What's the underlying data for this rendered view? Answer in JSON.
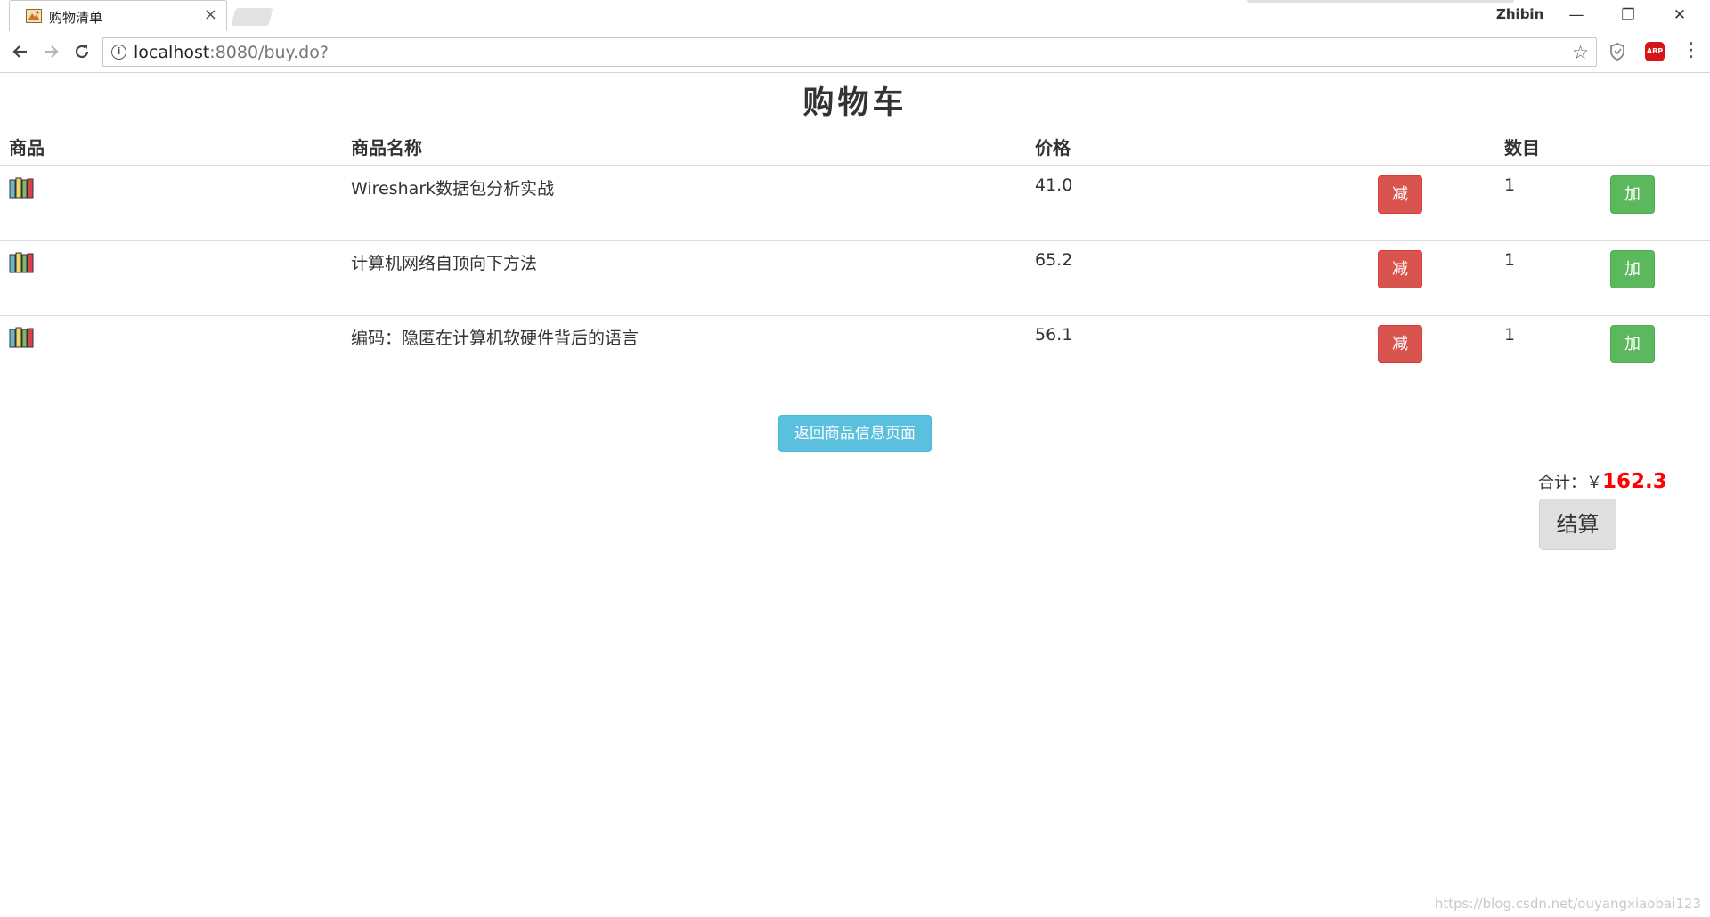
{
  "browser": {
    "tab_title": "购物清单",
    "tab_close": "×",
    "profile_name": "Zhibin",
    "window_controls": {
      "minimize": "—",
      "restore": "❐",
      "close": "✕"
    },
    "url_host": "localhost",
    "url_rest": ":8080/buy.do?",
    "icons": [
      "back-arrow-icon",
      "forward-arrow-icon",
      "reload-icon",
      "info-icon",
      "star-icon",
      "shield-icon",
      "abp-icon",
      "menu-icon"
    ],
    "abp_label": "ABP"
  },
  "page": {
    "title": "购物车",
    "headers": {
      "image": "商品",
      "name": "商品名称",
      "price": "价格",
      "qty": "数目"
    },
    "items": [
      {
        "name": "Wireshark数据包分析实战",
        "price": "41.0",
        "qty": "1",
        "minus": "减",
        "plus": "加"
      },
      {
        "name": "计算机网络自顶向下方法",
        "price": "65.2",
        "qty": "1",
        "minus": "减",
        "plus": "加"
      },
      {
        "name": "编码：隐匿在计算机软硬件背后的语言",
        "price": "56.1",
        "qty": "1",
        "minus": "减",
        "plus": "加"
      }
    ],
    "back_button": "返回商品信息页面",
    "total_label": "合计：￥",
    "total_value": "162.3",
    "checkout_button": "结算",
    "watermark": "https://blog.csdn.net/ouyangxiaobai123"
  },
  "colors": {
    "minus_button": "#d9534f",
    "plus_button": "#5cb85c",
    "back_button": "#5bc0de",
    "total_value": "#ff0000"
  }
}
